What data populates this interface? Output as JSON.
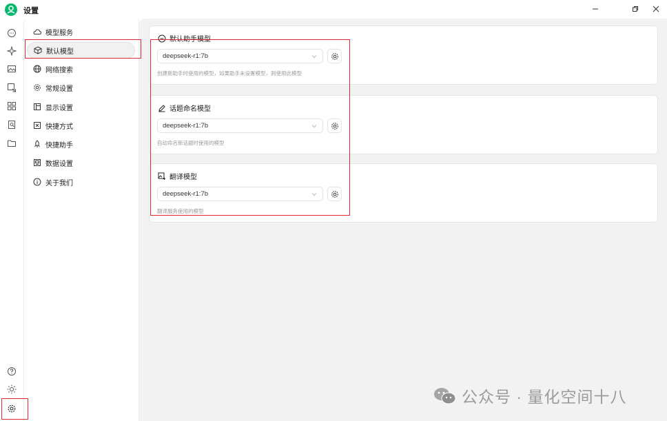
{
  "window": {
    "title": "设置",
    "minimize_icon": "minimize-icon",
    "restore_icon": "restore-icon",
    "close_icon": "close-icon"
  },
  "rail": {
    "icons": [
      "avatar-icon",
      "chat-icon",
      "sparkle-icon",
      "image-icon",
      "translate-icon",
      "apps-icon",
      "knowledge-icon",
      "folder-icon"
    ],
    "bottom_icons": [
      "help-icon",
      "theme-icon",
      "settings-icon"
    ]
  },
  "menu": {
    "items": [
      {
        "label": "模型服务",
        "icon": "cloud-icon"
      },
      {
        "label": "默认模型",
        "icon": "cube-icon",
        "active": true
      },
      {
        "label": "网络搜索",
        "icon": "globe-icon"
      },
      {
        "label": "常规设置",
        "icon": "gear-icon"
      },
      {
        "label": "显示设置",
        "icon": "layout-icon"
      },
      {
        "label": "快捷方式",
        "icon": "command-icon"
      },
      {
        "label": "快捷助手",
        "icon": "rocket-icon"
      },
      {
        "label": "数据设置",
        "icon": "database-icon"
      },
      {
        "label": "关于我们",
        "icon": "info-icon"
      }
    ]
  },
  "cards": [
    {
      "title": "默认助手模型",
      "icon": "chat-bubble-icon",
      "model": "deepseek-r1:7b",
      "hint": "创建新助手时使用的模型，如果助手未设置模型，则使用此模型"
    },
    {
      "title": "话题命名模型",
      "icon": "pencil-icon",
      "model": "deepseek-r1:7b",
      "hint": "自动命名新话题时使用的模型"
    },
    {
      "title": "翻译模型",
      "icon": "image-translate-icon",
      "model": "deepseek-r1:7b",
      "hint": "翻译服务使用的模型"
    }
  ],
  "watermark": {
    "text": "公众号 · 量化空间十八",
    "icon": "wechat-icon"
  },
  "colors": {
    "brand": "#00b96b",
    "highlight": "#e0282e",
    "background": "#f2f2f2"
  }
}
